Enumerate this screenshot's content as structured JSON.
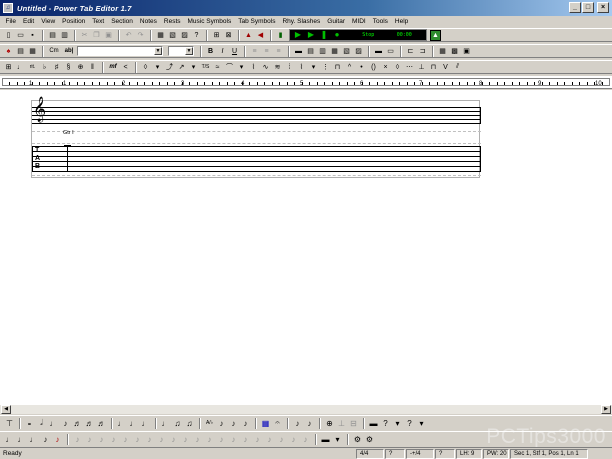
{
  "window": {
    "title": "Untitled - Power Tab Editor 1.7",
    "controls": [
      "_",
      "□",
      "×"
    ]
  },
  "menubar": {
    "items": [
      "File",
      "Edit",
      "View",
      "Position",
      "Text",
      "Section",
      "Notes",
      "Rests",
      "Music Symbols",
      "Tab Symbols",
      "Rhy. Slashes",
      "Guitar",
      "MIDI",
      "Tools",
      "Help"
    ]
  },
  "toolbar1": {
    "player": {
      "status": "Stop",
      "time": "00:00"
    }
  },
  "toolbar2": {
    "cm_label": "Cm",
    "abl_label": "ab|",
    "bold": "B",
    "italic": "I",
    "underline": "U"
  },
  "toolbar3": {
    "mf_label": "mf",
    "tr_label": "T/S"
  },
  "ruler": {
    "ticks": [
      "1",
      "1",
      "2",
      "3",
      "4",
      "5",
      "6",
      "7",
      "8",
      "9",
      "10"
    ]
  },
  "score": {
    "chord_label": "Gtr I",
    "tab_letters": [
      "T",
      "A",
      "B"
    ],
    "clef_glyph": "𝄞"
  },
  "statusbar": {
    "ready": "Ready",
    "time_sig": "4/4",
    "panel2": "?",
    "panel3": "-+/4",
    "panel4": "?",
    "lh": "LH: 9",
    "pw": "PW: 20",
    "position": "Sec 1, Stf 1, Pos 1, Ln 1"
  },
  "watermark": "PCTips3000",
  "colors": {
    "titlebar_start": "#0a246a",
    "titlebar_end": "#a6caf0",
    "window_bg": "#d4d0c8",
    "player_bg": "#000000",
    "player_text": "#00ff00"
  }
}
